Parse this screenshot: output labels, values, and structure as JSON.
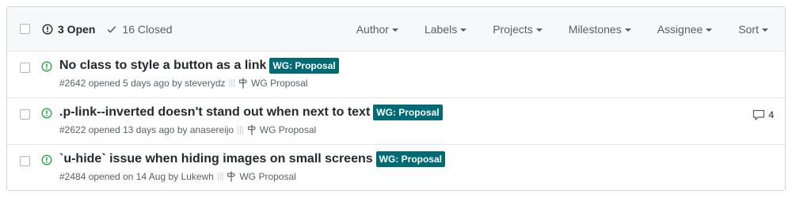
{
  "header": {
    "open_label": "3 Open",
    "closed_label": "16 Closed",
    "filters": [
      {
        "label": "Author",
        "name": "author-filter"
      },
      {
        "label": "Labels",
        "name": "labels-filter"
      },
      {
        "label": "Projects",
        "name": "projects-filter"
      },
      {
        "label": "Milestones",
        "name": "milestones-filter"
      },
      {
        "label": "Assignee",
        "name": "assignee-filter"
      },
      {
        "label": "Sort",
        "name": "sort-filter"
      }
    ]
  },
  "issues": [
    {
      "title": "No class to style a button as a link",
      "label": "WG: Proposal",
      "number": "#2642",
      "opened": "opened 5 days ago by",
      "author": "steverydz",
      "milestone": "WG Proposal",
      "comments": ""
    },
    {
      "title": ".p-link--inverted doesn't stand out when next to text",
      "label": "WG: Proposal",
      "number": "#2622",
      "opened": "opened 13 days ago by",
      "author": "anasereijo",
      "milestone": "WG Proposal",
      "comments": "4"
    },
    {
      "title": "`u-hide` issue when hiding images on small screens",
      "label": "WG: Proposal",
      "number": "#2484",
      "opened": "opened on 14 Aug by",
      "author": "Lukewh",
      "milestone": "WG Proposal",
      "comments": ""
    }
  ],
  "colors": {
    "label_bg": "#006b75",
    "open_icon": "#28a745",
    "header_bg": "#f6f8fa"
  },
  "icons": {
    "open_state": "issue-opened-icon",
    "closed_state": "check-icon",
    "milestone": "milestone-icon",
    "comment": "comment-icon"
  }
}
